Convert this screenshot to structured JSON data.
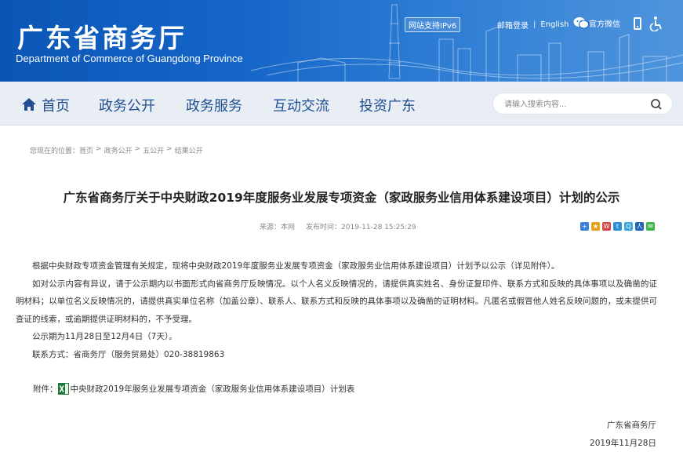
{
  "header": {
    "title": "广东省商务厅",
    "subtitle": "Department of Commerce of Guangdong Province",
    "ipv6_badge": "网站支持IPv6",
    "links": [
      "邮箱登录",
      "English"
    ],
    "separator": "|",
    "wechat_label": "官方微信"
  },
  "nav": {
    "items": [
      "首页",
      "政务公开",
      "政务服务",
      "互动交流",
      "投资广东"
    ],
    "search_placeholder": "请输入搜索内容..."
  },
  "breadcrumb": {
    "prefix": "您现在的位置：",
    "items": [
      "首页",
      "政务公开",
      "五公开",
      "结果公开"
    ],
    "separator": ">"
  },
  "article": {
    "title": "广东省商务厅关于中央财政2019年度服务业发展专项资金（家政服务业信用体系建设项目）计划的公示",
    "source": "来源：本网",
    "published": "发布时间：2019-11-28 15:25:29",
    "paragraphs": [
      "根据中央财政专项资金管理有关规定，现将中央财政2019年度服务业发展专项资金（家政服务业信用体系建设项目）计划予以公示（详见附件）。",
      "如对公示内容有异议，请于公示期内以书面形式向省商务厅反映情况。以个人名义反映情况的，请提供真实姓名、身份证复印件、联系方式和反映的具体事项以及确凿的证明材料；以单位名义反映情况的，请提供真实单位名称（加盖公章）、联系人、联系方式和反映的具体事项以及确凿的证明材料。凡匿名或假冒他人姓名反映问题的，或未提供可查证的线索，或逾期提供证明材料的，不予受理。",
      "公示期为11月28日至12月4日（7天）。",
      "联系方式：省商务厅（服务贸易处）020-38819863"
    ],
    "attachment_label": "附件：",
    "attachment_name": "中央财政2019年服务业发展专项资金（家政服务业信用体系建设项目）计划表",
    "signature_org": "广东省商务厅",
    "signature_date": "2019年11月28日"
  },
  "colors": {
    "banner": "#1565c8",
    "nav_text": "#1f4f92",
    "nav_bg": "#e9eef5"
  }
}
